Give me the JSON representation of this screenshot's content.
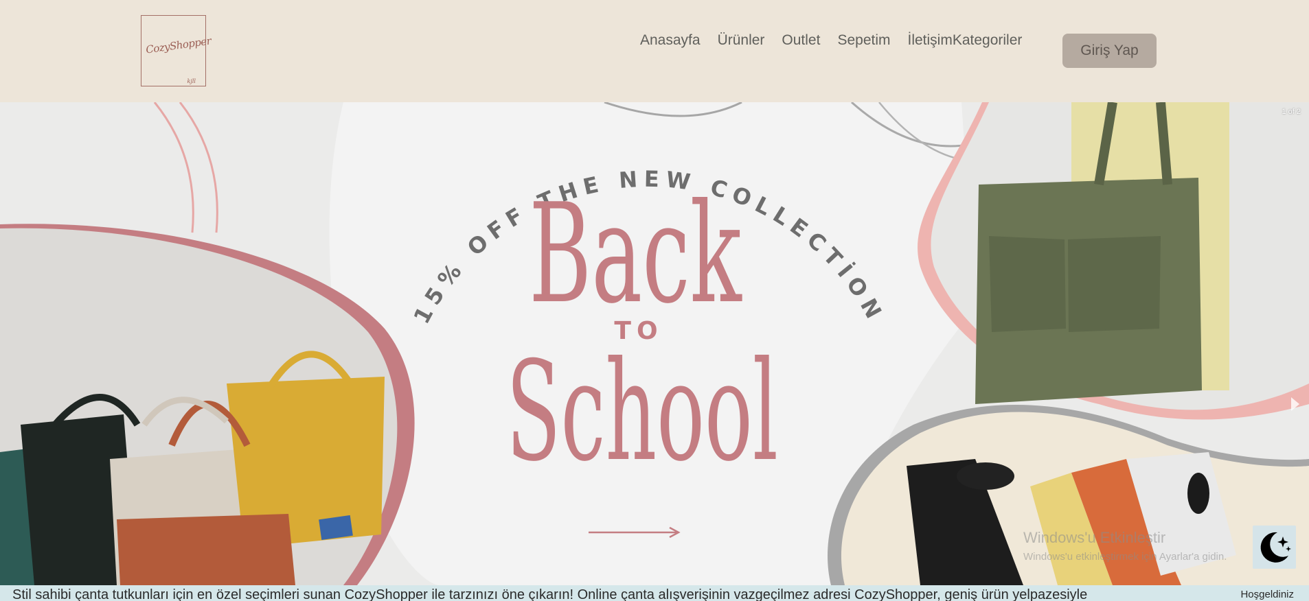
{
  "header": {
    "logo_text": "CozyShopper",
    "logo_subtext": "kjll"
  },
  "nav": {
    "items": [
      "Anasayfa",
      "Ürünler",
      "Outlet",
      "Sepetim",
      "İletişim",
      "Kategoriler"
    ]
  },
  "login": {
    "label": "Giriş Yap"
  },
  "hero": {
    "slide_counter": "1 of 2",
    "arc_text": "15% OFF THE NEW COLLECTİON",
    "title_top": "Back",
    "title_mid": "TO",
    "title_bottom": "School"
  },
  "watermark": {
    "line1": "Windows'u Etkinleştir",
    "line2": "Windows'u etkinleştirmek için Ayarlar'a gidin."
  },
  "ticker": {
    "message": "Stil sahibi çanta tutkunları için en özel seçimleri sunan CozyShopper ile tarzınızı öne çıkarın! Online çanta alışverişinin vazgeçilmez adresi CozyShopper, geniş ürün yelpazesiyle",
    "welcome": "Hoşgeldiniz"
  },
  "colors": {
    "header_bg": "#ede5d9",
    "accent_pink": "#c47d82",
    "arc_text": "#6d6d6d",
    "login_bg": "#b5aaa0",
    "ticker_bg": "#d5e7ea"
  }
}
